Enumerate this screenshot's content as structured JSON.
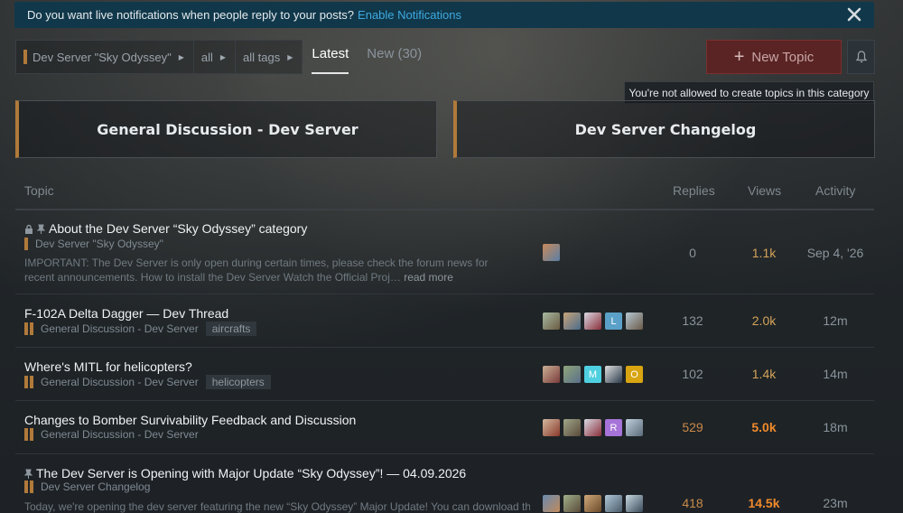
{
  "banner": {
    "text": "Do you want live notifications when people reply to your posts?",
    "link": "Enable Notifications"
  },
  "breadcrumbs": [
    {
      "label": "Dev Server \"Sky Odyssey\"",
      "has_bar": true
    },
    {
      "label": "all",
      "has_bar": false
    },
    {
      "label": "all tags",
      "has_bar": false
    }
  ],
  "tabs": [
    {
      "label": "Latest",
      "active": true
    },
    {
      "label": "New (30)",
      "active": false
    }
  ],
  "new_topic_label": "New Topic",
  "tooltip": "You're not allowed to create topics in this category",
  "categories": [
    {
      "label": "General Discussion - Dev Server"
    },
    {
      "label": "Dev Server Changelog"
    }
  ],
  "table_header": {
    "topic": "Topic",
    "replies": "Replies",
    "views": "Views",
    "activity": "Activity"
  },
  "topics": [
    {
      "title": "About the Dev Server “Sky Odyssey” category",
      "category": "Dev Server \"Sky Odyssey\"",
      "excerpt": "IMPORTANT: The Dev Server is only open during certain times, please check the forum news for recent announcements. How to install the Dev Server Watch the Official Proj…",
      "read_more": "read more",
      "replies": "0",
      "views": "1.1k",
      "activity": "Sep 4, '26"
    },
    {
      "title": "F-102A Delta Dagger — Dev Thread",
      "category": "General Discussion - Dev Server",
      "tag": "aircrafts",
      "replies": "132",
      "views": "2.0k",
      "activity": "12m",
      "letter": "L"
    },
    {
      "title": "Where's MITL for helicopters?",
      "category": "General Discussion - Dev Server",
      "tag": "helicopters",
      "replies": "102",
      "views": "1.4k",
      "activity": "14m",
      "letter1": "M",
      "letter2": "O"
    },
    {
      "title": "Changes to Bomber Survivability Feedback and Discussion",
      "category": "General Discussion - Dev Server",
      "replies": "529",
      "views": "5.0k",
      "activity": "18m",
      "letter": "R"
    },
    {
      "title": "The Dev Server is Opening with Major Update “Sky Odyssey”! — 04.09.2026",
      "category": "Dev Server Changelog",
      "excerpt": "Today, we're opening the dev server featuring the new “Sky Odyssey” Major Update! You can download the",
      "replies": "418",
      "views": "14.5k",
      "activity": "23m"
    }
  ],
  "colors": {
    "category_bar": "#b07a3a",
    "link": "#3fa9e0",
    "new_topic_bg": "#5a2424",
    "views_warm": "#d4a35a",
    "views_hot": "#f08a2c"
  }
}
